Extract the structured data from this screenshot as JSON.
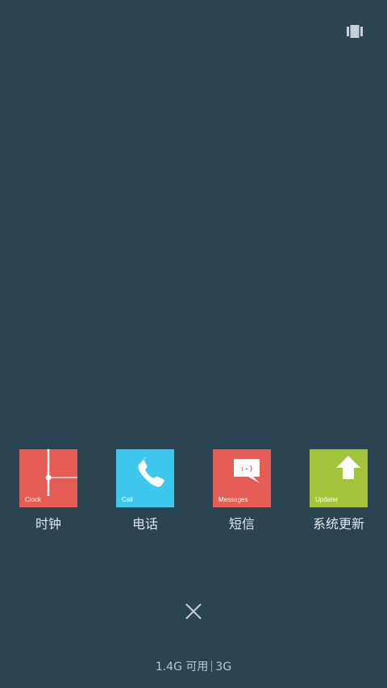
{
  "top_right_button": {
    "icon": "recent-tasks-icon"
  },
  "apps": [
    {
      "tile_label": "Clock",
      "name": "时钟",
      "color": "#e55c57",
      "icon": "clock-icon"
    },
    {
      "tile_label": "Call",
      "name": "电话",
      "color": "#3ec8ee",
      "icon": "phone-icon"
    },
    {
      "tile_label": "Messages",
      "name": "短信",
      "color": "#e55c57",
      "icon": "message-icon"
    },
    {
      "tile_label": "Updater",
      "name": "系统更新",
      "color": "#a3c43a",
      "icon": "upload-arrow-icon"
    }
  ],
  "message_glyph": ":-)",
  "close_button": {
    "icon": "close-icon"
  },
  "status": {
    "memory": "1.4G 可用",
    "network": "3G"
  }
}
